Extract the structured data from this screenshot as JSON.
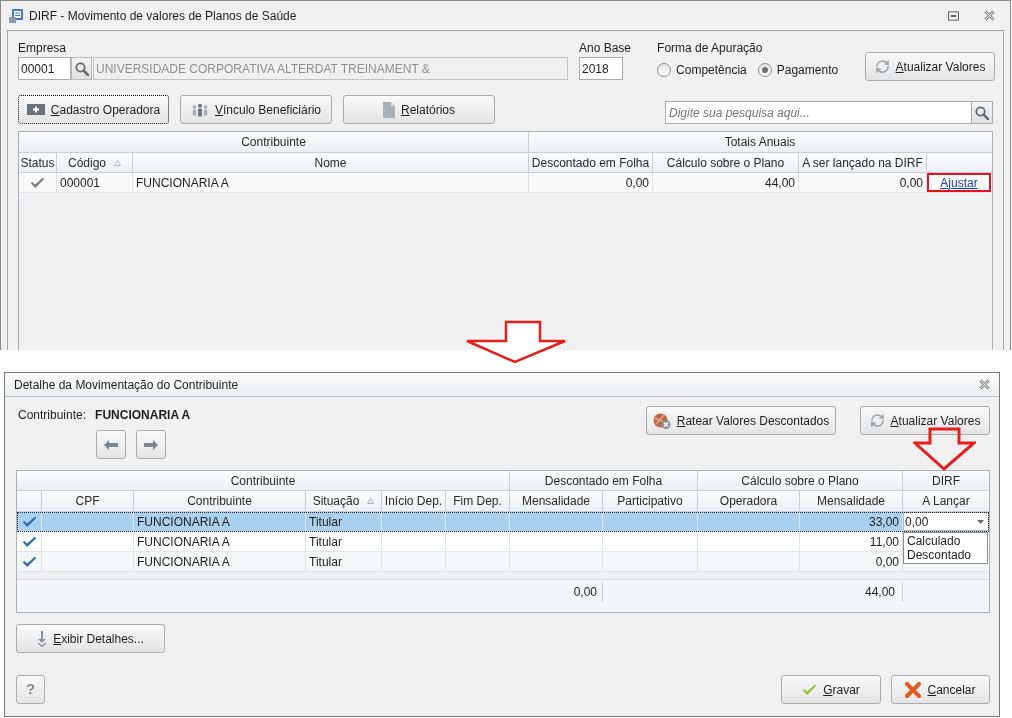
{
  "main_window": {
    "title": "DIRF - Movimento de valores de Planos de Saúde",
    "empresa": {
      "label": "Empresa",
      "code": "00001",
      "name": "UNIVERSIDADE CORPORATIVA ALTERDAT TREINAMENT &"
    },
    "ano_base": {
      "label": "Ano Base",
      "value": "2018"
    },
    "forma_apuracao": {
      "label": "Forma de Apuração",
      "options": [
        {
          "label": "Competência",
          "selected": false
        },
        {
          "label": "Pagamento",
          "selected": true
        }
      ]
    },
    "refresh_button": {
      "label": "Atualizar Valores"
    },
    "action_buttons": [
      {
        "kind": "add",
        "label": "Cadastro Operadora",
        "focused": true
      },
      {
        "kind": "people",
        "label": "Vínculo Beneficiário",
        "focused": false
      },
      {
        "kind": "report",
        "label": "Relatórios",
        "focused": false
      }
    ],
    "search": {
      "placeholder": "Digite sua pesquisa aqui..."
    },
    "table": {
      "bands": [
        {
          "label": "Contribuinte",
          "columns": [
            {
              "kind": "check",
              "label": "Status",
              "sorted": false
            },
            {
              "kind": "text",
              "label": "Código",
              "sorted": true
            },
            {
              "kind": "text",
              "label": "Nome",
              "sorted": false
            }
          ]
        },
        {
          "label": "Totais Anuais",
          "columns": [
            {
              "kind": "number",
              "label": "Descontado em Folha",
              "sorted": false
            },
            {
              "kind": "number",
              "label": "Cálculo sobre o Plano",
              "sorted": false
            },
            {
              "kind": "number",
              "label": "A ser lançado na DIRF",
              "sorted": false
            },
            {
              "kind": "link"
            }
          ]
        }
      ],
      "rows": [
        {
          "checked": true,
          "cells": [
            "000001",
            "FUNCIONARIA A",
            "0,00",
            "44,00",
            "0,00"
          ],
          "link": {
            "label": "Ajustar",
            "annotated": true
          }
        }
      ]
    }
  },
  "detail_window": {
    "title": "Detalhe da Movimentação do Contribuinte",
    "contribuinte": {
      "label": "Contribuinte:",
      "value": "FUNCIONARIA A"
    },
    "toolbar_buttons": [
      {
        "kind": "split",
        "label": "Ratear Valores Descontados"
      },
      {
        "kind": "refresh",
        "label": "Atualizar Valores"
      }
    ],
    "table": {
      "bands": [
        {
          "label": "Contribuinte",
          "columns": [
            {
              "kind": "check"
            },
            {
              "kind": "text",
              "label": "CPF",
              "sorted": false
            },
            {
              "kind": "text",
              "label": "Contribuinte",
              "sorted": false
            },
            {
              "kind": "text",
              "label": "Situação",
              "sorted": true
            },
            {
              "kind": "text",
              "label": "Início Dep.",
              "sorted": false
            },
            {
              "kind": "text",
              "label": "Fim Dep.",
              "sorted": false
            }
          ]
        },
        {
          "label": "Descontado em Folha",
          "columns": [
            {
              "kind": "number",
              "label": "Mensalidade",
              "sorted": false
            },
            {
              "kind": "number",
              "label": "Participativo",
              "sorted": false
            }
          ]
        },
        {
          "label": "Cálculo sobre o Plano",
          "columns": [
            {
              "kind": "number",
              "label": "Operadora",
              "sorted": false
            },
            {
              "kind": "number",
              "label": "Mensalidade",
              "sorted": false
            }
          ]
        },
        {
          "label": "DIRF",
          "columns": [
            {
              "kind": "editor",
              "label": "A Lançar",
              "sorted": false
            }
          ]
        }
      ],
      "rows": [
        {
          "selected": true,
          "checked": true,
          "editing": true,
          "cells": [
            null,
            "FUNCIONARIA A",
            "Titular",
            null,
            null,
            null,
            null,
            null,
            "33,00",
            "0,00"
          ],
          "options": [
            "Calculado",
            "Descontado"
          ]
        },
        {
          "selected": false,
          "checked": true,
          "editing": false,
          "cells": [
            null,
            "FUNCIONARIA A",
            "Titular",
            null,
            null,
            null,
            null,
            null,
            "11,00",
            null
          ]
        },
        {
          "selected": false,
          "checked": true,
          "editing": false,
          "cells": [
            null,
            "FUNCIONARIA A",
            "Titular",
            null,
            null,
            null,
            null,
            null,
            "0,00",
            null
          ]
        }
      ],
      "totals": [
        "0,00",
        "44,00"
      ]
    },
    "details_button": {
      "label": "Exibir Detalhes..."
    },
    "help_button": {
      "label": "?"
    },
    "dialog_buttons": [
      {
        "kind": "save",
        "label": "Gravar"
      },
      {
        "kind": "cancel",
        "label": "Cancelar"
      }
    ]
  }
}
